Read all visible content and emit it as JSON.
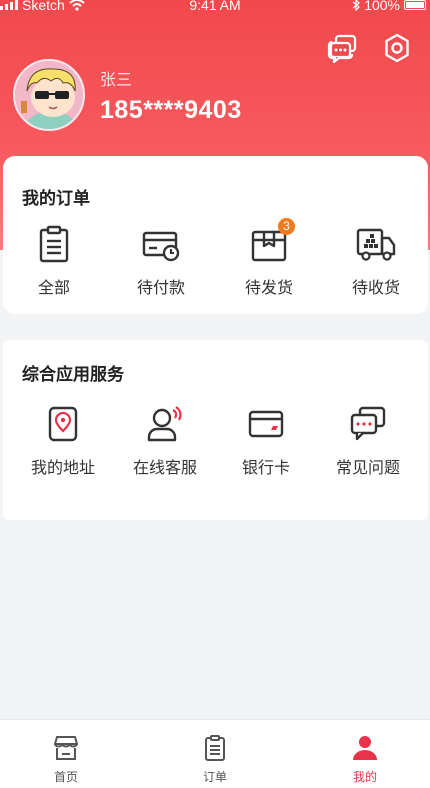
{
  "status_bar": {
    "carrier": "Sketch",
    "time": "9:41 AM",
    "battery": "100%"
  },
  "header": {
    "message_icon": "chat-icon",
    "settings_icon": "gear-icon",
    "user": {
      "name": "张三",
      "phone": "185****9403"
    }
  },
  "orders": {
    "title": "我的订单",
    "items": [
      {
        "label": "全部",
        "icon": "clipboard-list-icon"
      },
      {
        "label": "待付款",
        "icon": "card-clock-icon"
      },
      {
        "label": "待发货",
        "icon": "package-box-icon",
        "badge": "3"
      },
      {
        "label": "待收货",
        "icon": "delivery-truck-icon"
      }
    ]
  },
  "services": {
    "title": "综合应用服务",
    "items": [
      {
        "label": "我的地址",
        "icon": "location-pin-icon"
      },
      {
        "label": "在线客服",
        "icon": "customer-service-icon"
      },
      {
        "label": "银行卡",
        "icon": "bank-card-icon"
      },
      {
        "label": "常见问题",
        "icon": "faq-chat-icon"
      }
    ]
  },
  "tab_bar": {
    "tabs": [
      {
        "label": "首页",
        "icon": "store-icon",
        "active": false
      },
      {
        "label": "订单",
        "icon": "order-list-icon",
        "active": false
      },
      {
        "label": "我的",
        "icon": "user-icon",
        "active": true
      }
    ]
  },
  "colors": {
    "accent": "#f2484c",
    "active_tab": "#e8334a",
    "badge": "#f07a1d"
  }
}
